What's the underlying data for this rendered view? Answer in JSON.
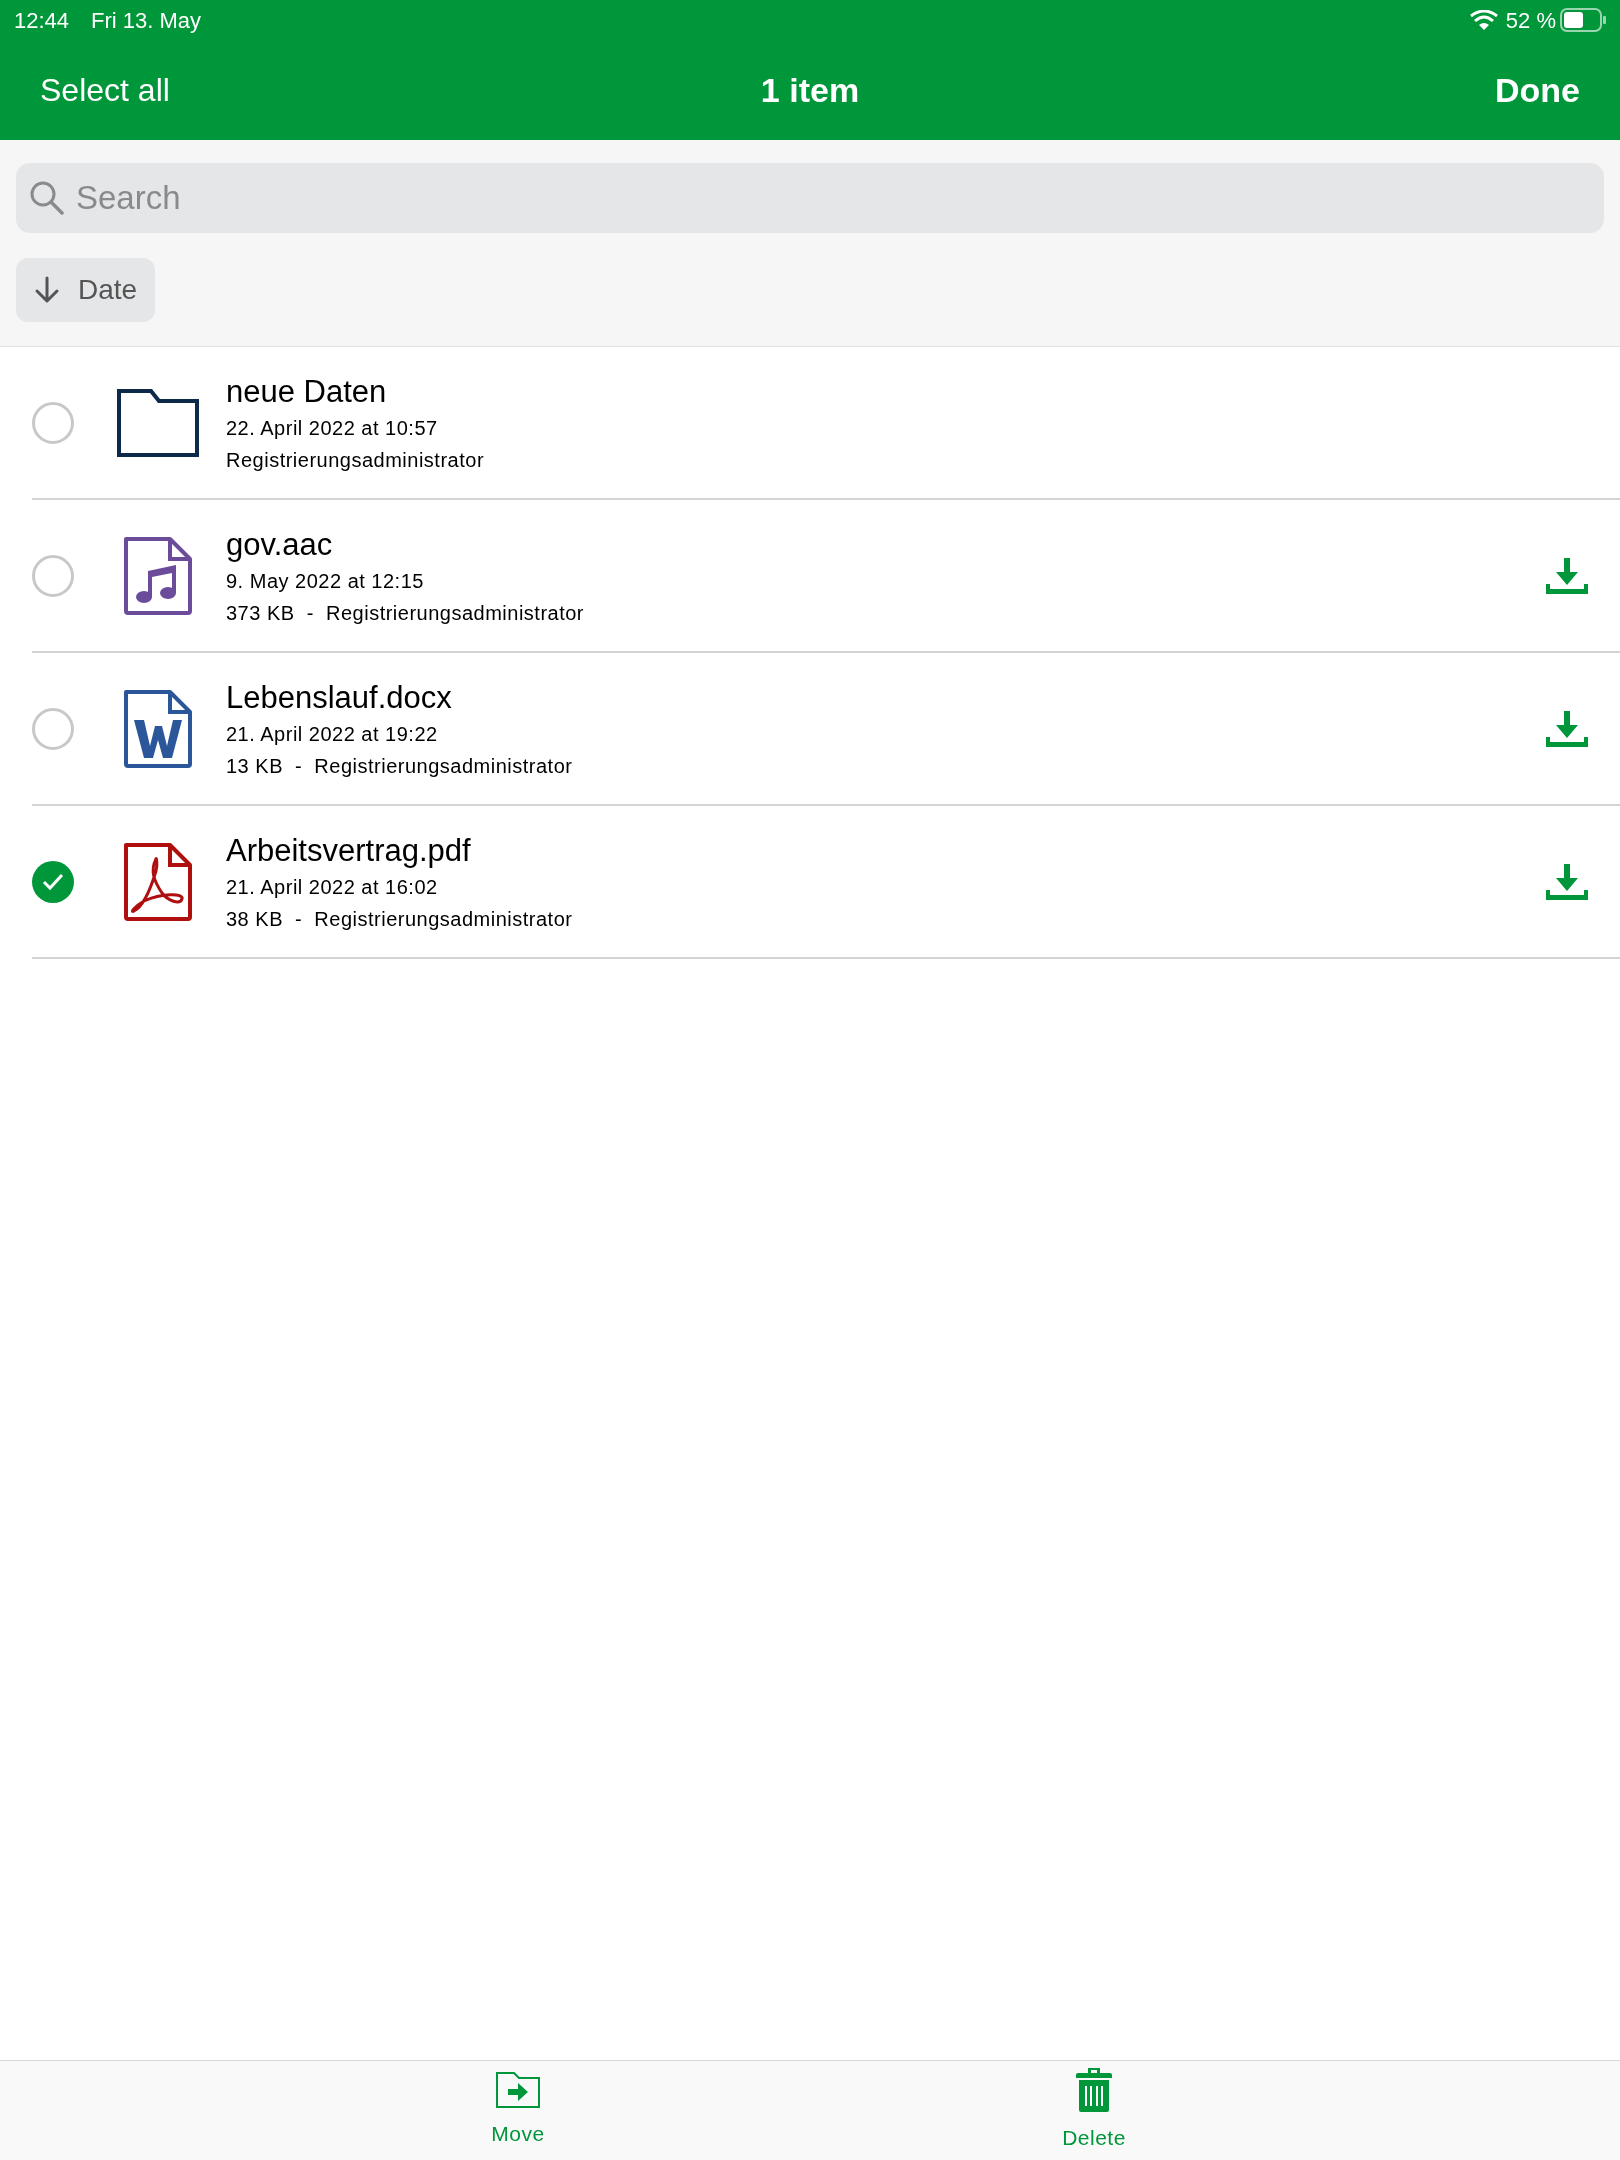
{
  "status_bar": {
    "time": "12:44",
    "date": "Fri 13. May",
    "battery": "52 %"
  },
  "nav_bar": {
    "left": "Select all",
    "title": "1 item",
    "right": "Done"
  },
  "search": {
    "placeholder": "Search"
  },
  "sort": {
    "label": "Date"
  },
  "files": [
    {
      "kind": "folder",
      "name": "neue Daten",
      "date": "22. April 2022 at 10:57",
      "details": "Registrierungsadministrator",
      "selected": false,
      "download": false
    },
    {
      "kind": "audio",
      "name": "gov.aac",
      "date": "9. May 2022 at 12:15",
      "details": "373 KB  -  Registrierungsadministrator",
      "selected": false,
      "download": true
    },
    {
      "kind": "word",
      "name": "Lebenslauf.docx",
      "date": "21. April 2022 at 19:22",
      "details": "13 KB  -  Registrierungsadministrator",
      "selected": false,
      "download": true
    },
    {
      "kind": "pdf",
      "name": "Arbeitsvertrag.pdf",
      "date": "21. April 2022 at 16:02",
      "details": "38 KB  -  Registrierungsadministrator",
      "selected": true,
      "download": true
    }
  ],
  "toolbar": [
    {
      "kind": "move",
      "label": "Move"
    },
    {
      "kind": "delete",
      "label": "Delete"
    }
  ]
}
